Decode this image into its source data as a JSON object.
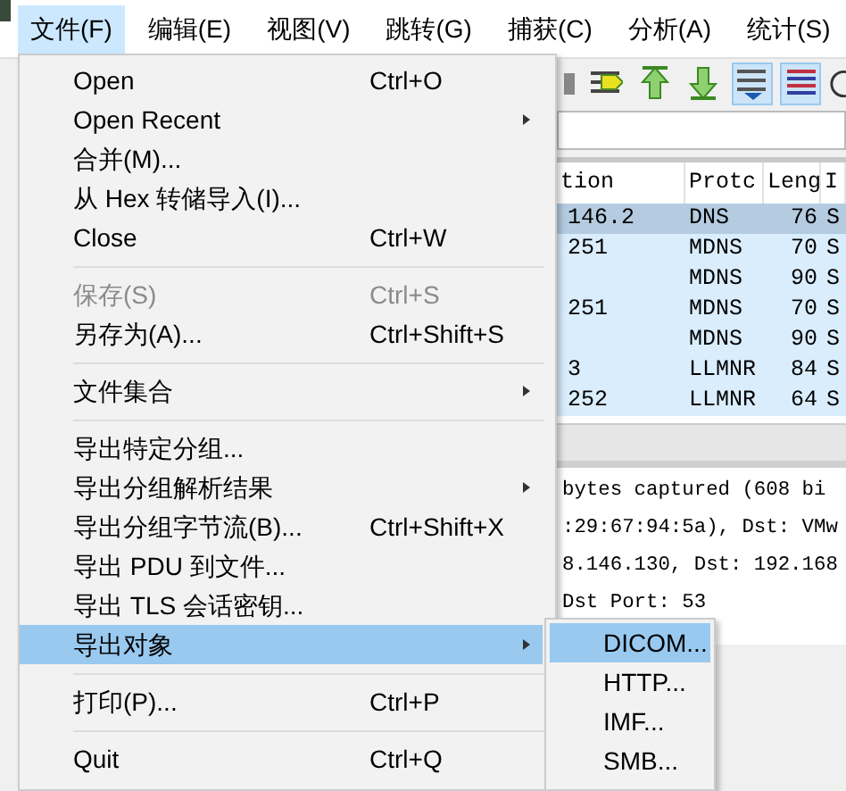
{
  "menubar": [
    {
      "label": "文件(F)",
      "selected": true
    },
    {
      "label": "编辑(E)",
      "selected": false
    },
    {
      "label": "视图(V)",
      "selected": false
    },
    {
      "label": "跳转(G)",
      "selected": false
    },
    {
      "label": "捕获(C)",
      "selected": false
    },
    {
      "label": "分析(A)",
      "selected": false
    },
    {
      "label": "统计(S)",
      "selected": false
    }
  ],
  "toolbar": [
    {
      "kind": "find",
      "pressed": false
    },
    {
      "kind": "first",
      "pressed": false
    },
    {
      "kind": "last",
      "pressed": false
    },
    {
      "kind": "autoscroll",
      "pressed": true
    },
    {
      "kind": "colorize",
      "pressed": true
    }
  ],
  "packet_list": {
    "columns": [
      "tion",
      "Protc",
      "Leng",
      "I"
    ],
    "rows": [
      {
        "cells": [
          "146.2",
          "DNS",
          "76",
          "S"
        ],
        "selected": true
      },
      {
        "cells": [
          "251",
          "MDNS",
          "70",
          "S"
        ],
        "selected": false
      },
      {
        "cells": [
          "",
          "MDNS",
          "90",
          "S"
        ],
        "selected": false
      },
      {
        "cells": [
          "251",
          "MDNS",
          "70",
          "S"
        ],
        "selected": false
      },
      {
        "cells": [
          "",
          "MDNS",
          "90",
          "S"
        ],
        "selected": false
      },
      {
        "cells": [
          "3",
          "LLMNR",
          "84",
          "S"
        ],
        "selected": false
      },
      {
        "cells": [
          "252",
          "LLMNR",
          "64",
          "S"
        ],
        "selected": false
      }
    ]
  },
  "details": [
    "bytes captured (608 bi",
    ":29:67:94:5a), Dst: VMw",
    "8.146.130, Dst: 192.168",
    "Dst Port: 53"
  ],
  "file_menu": {
    "items": [
      {
        "kind": "item",
        "label": "Open",
        "shortcut": "Ctrl+O",
        "submenu": false,
        "disabled": false,
        "selected": false
      },
      {
        "kind": "item",
        "label": "Open Recent",
        "submenu": true,
        "disabled": false,
        "selected": false
      },
      {
        "kind": "item",
        "label": "合并(M)...",
        "submenu": false,
        "disabled": false,
        "selected": false
      },
      {
        "kind": "item",
        "label": "从 Hex 转储导入(I)...",
        "submenu": false,
        "disabled": false,
        "selected": false
      },
      {
        "kind": "item",
        "label": "Close",
        "shortcut": "Ctrl+W",
        "submenu": false,
        "disabled": false,
        "selected": false
      },
      {
        "kind": "separator"
      },
      {
        "kind": "item",
        "label": "保存(S)",
        "shortcut": "Ctrl+S",
        "submenu": false,
        "disabled": true,
        "selected": false
      },
      {
        "kind": "item",
        "label": "另存为(A)...",
        "shortcut": "Ctrl+Shift+S",
        "submenu": false,
        "disabled": false,
        "selected": false
      },
      {
        "kind": "separator"
      },
      {
        "kind": "item",
        "label": "文件集合",
        "submenu": true,
        "disabled": false,
        "selected": false
      },
      {
        "kind": "separator"
      },
      {
        "kind": "item",
        "label": "导出特定分组...",
        "submenu": false,
        "disabled": false,
        "selected": false
      },
      {
        "kind": "item",
        "label": "导出分组解析结果",
        "submenu": true,
        "disabled": false,
        "selected": false
      },
      {
        "kind": "item",
        "label": "导出分组字节流(B)...",
        "shortcut": "Ctrl+Shift+X",
        "submenu": false,
        "disabled": false,
        "selected": false
      },
      {
        "kind": "item",
        "label": "导出 PDU 到文件...",
        "submenu": false,
        "disabled": false,
        "selected": false
      },
      {
        "kind": "item",
        "label": "导出 TLS 会话密钥...",
        "submenu": false,
        "disabled": false,
        "selected": false
      },
      {
        "kind": "item",
        "label": "导出对象",
        "submenu": true,
        "disabled": false,
        "selected": true
      },
      {
        "kind": "separator"
      },
      {
        "kind": "item",
        "label": "打印(P)...",
        "shortcut": "Ctrl+P",
        "submenu": false,
        "disabled": false,
        "selected": false
      },
      {
        "kind": "separator"
      },
      {
        "kind": "item",
        "label": "Quit",
        "shortcut": "Ctrl+Q",
        "submenu": false,
        "disabled": false,
        "selected": false
      }
    ]
  },
  "export_submenu": {
    "items": [
      {
        "label": "DICOM...",
        "selected": true
      },
      {
        "label": "HTTP...",
        "selected": false
      },
      {
        "label": "IMF...",
        "selected": false
      },
      {
        "label": "SMB...",
        "selected": false
      }
    ]
  }
}
